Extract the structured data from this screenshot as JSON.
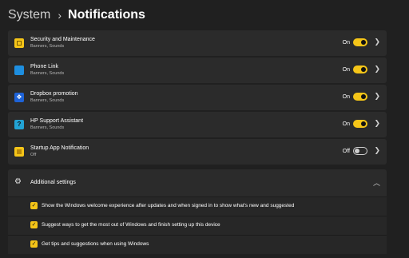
{
  "header": {
    "section": "System",
    "separator": "›",
    "page": "Notifications"
  },
  "apps": [
    {
      "title": "Security and Maintenance",
      "subtitle": "Banners, Sounds",
      "state": "On",
      "on": true,
      "icon": "security-maintenance-icon"
    },
    {
      "title": "Phone Link",
      "subtitle": "Banners, Sounds",
      "state": "On",
      "on": true,
      "icon": "phone-link-icon"
    },
    {
      "title": "Dropbox promotion",
      "subtitle": "Banners, Sounds",
      "state": "On",
      "on": true,
      "icon": "dropbox-icon"
    },
    {
      "title": "HP Support Assistant",
      "subtitle": "Banners, Sounds",
      "state": "On",
      "on": true,
      "icon": "hp-support-icon"
    },
    {
      "title": "Startup App Notification",
      "subtitle": "Off",
      "state": "Off",
      "on": false,
      "icon": "startup-app-icon"
    }
  ],
  "additional": {
    "title": "Additional settings",
    "icon": "gear-icon",
    "items": [
      {
        "label": "Show the Windows welcome experience after updates and when signed in to show what's new and suggested",
        "checked": true
      },
      {
        "label": "Suggest ways to get the most out of Windows and finish setting up this device",
        "checked": true
      },
      {
        "label": "Get tips and suggestions when using Windows",
        "checked": true
      }
    ]
  },
  "colors": {
    "accent": "#f5c518",
    "background": "#202020",
    "card": "#2b2b2b"
  }
}
